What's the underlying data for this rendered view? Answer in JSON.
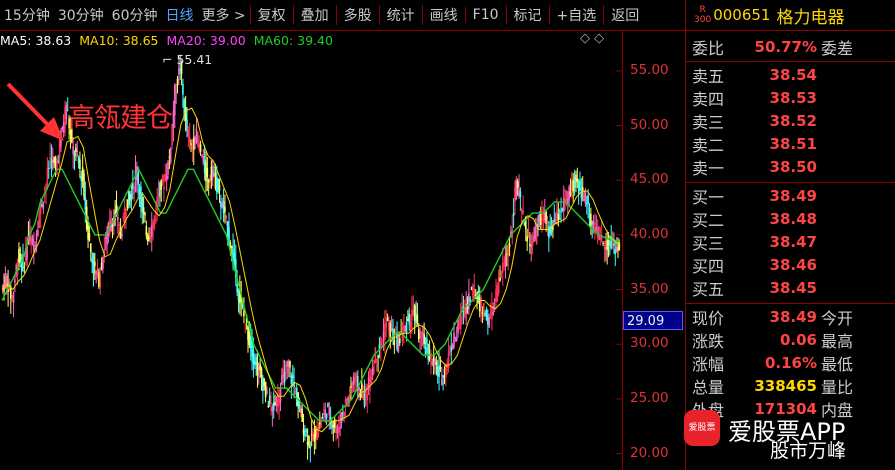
{
  "toolbar": {
    "periods": [
      "15分钟",
      "30分钟",
      "60分钟",
      "日线",
      "更多 >"
    ],
    "active_period": "日线",
    "tools": [
      "复权",
      "叠加",
      "多股",
      "统计",
      "画线",
      "F10",
      "标记",
      "+自选",
      "返回"
    ]
  },
  "ma_legend": [
    {
      "label": "MA5: 38.63",
      "color": "#ffffff"
    },
    {
      "label": "MA10: 38.65",
      "color": "#ffd700"
    },
    {
      "label": "MA20: 39.00",
      "color": "#ff44ff"
    },
    {
      "label": "MA60: 39.40",
      "color": "#22cc22"
    }
  ],
  "ctrl_icons": "◇ ◇",
  "annotation": "高瓴建仓",
  "peak_label": "55.41",
  "current_price_tag": "29.09",
  "stock": {
    "index_tag_top": "R",
    "index_tag_bottom": "300",
    "code": "000651",
    "name": "格力电器"
  },
  "weibi": {
    "label": "委比",
    "value": "50.77%",
    "label2": "委差"
  },
  "sell": [
    {
      "label": "卖五",
      "price": "38.54"
    },
    {
      "label": "卖四",
      "price": "38.53"
    },
    {
      "label": "卖三",
      "price": "38.52"
    },
    {
      "label": "卖二",
      "price": "38.51"
    },
    {
      "label": "卖一",
      "price": "38.50"
    }
  ],
  "buy": [
    {
      "label": "买一",
      "price": "38.49"
    },
    {
      "label": "买二",
      "price": "38.48"
    },
    {
      "label": "买三",
      "price": "38.47"
    },
    {
      "label": "买四",
      "price": "38.46"
    },
    {
      "label": "买五",
      "price": "38.45"
    }
  ],
  "quote": [
    {
      "label": "现价",
      "value": "38.49",
      "label2": "今开",
      "color": "#ff4444"
    },
    {
      "label": "涨跌",
      "value": "0.06",
      "label2": "最高",
      "color": "#ff4444"
    },
    {
      "label": "涨幅",
      "value": "0.16%",
      "label2": "最低",
      "color": "#ff4444"
    },
    {
      "label": "总量",
      "value": "338465",
      "label2": "量比",
      "color": "#ffd700"
    },
    {
      "label": "外盘",
      "value": "171304",
      "label2": "内盘",
      "color": "#ff4444"
    }
  ],
  "watermark": {
    "logo": "爱股票",
    "title": "爱股票APP",
    "sub": "股市万峰"
  },
  "chart_data": {
    "type": "line",
    "y_ticks": [
      55.0,
      50.0,
      45.0,
      40.0,
      35.0,
      30.0,
      25.0,
      20.0
    ],
    "ylim": [
      18.5,
      57.0
    ],
    "price_path": [
      35,
      36,
      34,
      38,
      37,
      40,
      39,
      42,
      44,
      47,
      46,
      49,
      52,
      48,
      47,
      45,
      40,
      37,
      36,
      39,
      41,
      42,
      40,
      43,
      44,
      46,
      42,
      40,
      41,
      44,
      45,
      47,
      53,
      55.41,
      50,
      48,
      49,
      47,
      45,
      46,
      44,
      42,
      40,
      37,
      34,
      32,
      30,
      28,
      27,
      25,
      24,
      25,
      27,
      28,
      26,
      24,
      22,
      21,
      22,
      23,
      24,
      23,
      22,
      24,
      25,
      27,
      26,
      25,
      27,
      29,
      30,
      32,
      31,
      30,
      31,
      32,
      33,
      31,
      30,
      29,
      28,
      27,
      28,
      30,
      31,
      33,
      34,
      35,
      34,
      33,
      32,
      34,
      36,
      38,
      40,
      45,
      42,
      40,
      39,
      41,
      42,
      40,
      41,
      42,
      43,
      44,
      45,
      44,
      43,
      41,
      40,
      39.5,
      39.2,
      39,
      38.6
    ],
    "ma60_path": [
      34,
      35,
      36,
      37,
      38,
      40,
      41,
      43,
      44,
      45,
      46,
      46,
      45,
      44,
      43,
      42,
      41,
      40,
      40,
      40,
      41,
      42,
      43,
      44,
      45,
      46,
      45,
      44,
      43,
      42,
      42,
      43,
      44,
      45,
      46,
      46,
      45,
      44,
      43,
      42,
      41,
      40,
      38,
      36,
      34,
      32,
      30,
      29,
      28,
      27,
      26,
      26,
      26,
      25.5,
      25,
      24.5,
      24,
      23.5,
      23,
      23,
      23,
      23.5,
      24,
      24.5,
      25,
      26,
      27,
      28,
      29,
      29.5,
      30,
      30.5,
      31,
      31,
      30.5,
      30,
      29.5,
      29,
      29,
      29,
      29.5,
      30,
      31,
      32,
      33,
      33.5,
      34,
      34.5,
      35,
      36,
      37,
      38,
      39,
      40,
      40.5,
      41,
      41.5,
      42,
      42,
      42,
      42.5,
      43,
      43,
      43,
      42.5,
      42,
      41.5,
      41,
      40.5,
      40,
      39.8,
      39.6,
      39.5,
      39.4
    ]
  }
}
